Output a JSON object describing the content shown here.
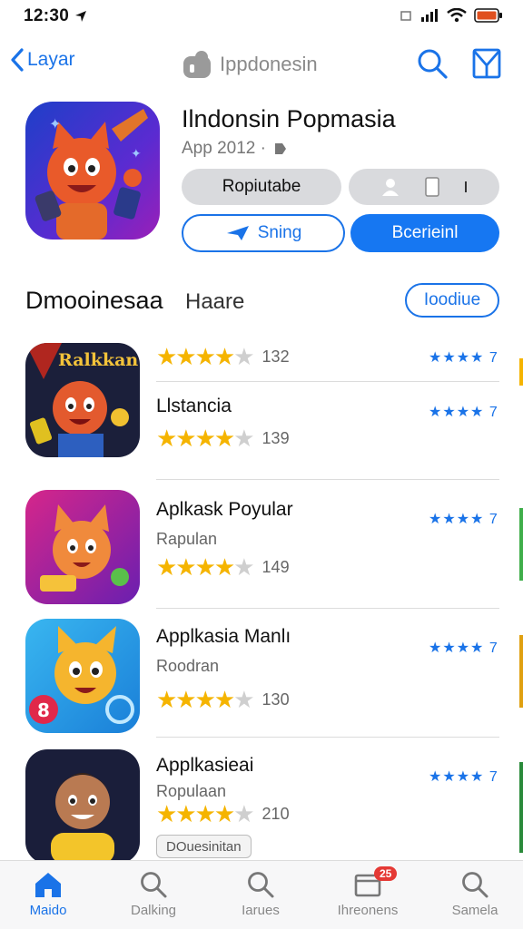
{
  "status": {
    "time": "12:30"
  },
  "nav": {
    "back_label": "Layar",
    "title": "Ippdonesin"
  },
  "hero": {
    "title": "Ilndonsin Popmasia",
    "subtitle": "App 2012 ·",
    "gray_button": "Ropiutabe",
    "outline_button": "Sning",
    "primary_button": "Bcerieinl"
  },
  "section": {
    "title": "Dmooinesaa",
    "subtitle": "Haare",
    "button": "Ioodiue"
  },
  "apps": [
    {
      "title": "",
      "subtitle": "",
      "icon_text": "Ralkkan",
      "stars": 4.5,
      "rating_count": "132",
      "mini_stars": "★★★★ 7"
    },
    {
      "title": "Llstancia",
      "subtitle": "",
      "stars": 4.5,
      "rating_count": "139",
      "mini_stars": "★★★★ 7"
    },
    {
      "title": "Aplkask Poyular",
      "subtitle": "Rapulan",
      "stars": 4.5,
      "rating_count": "149",
      "mini_stars": "★★★★ 7"
    },
    {
      "title": "Applkasia Manlı",
      "subtitle": "Roodran",
      "stars": 4.5,
      "rating_count": "130",
      "mini_stars": "★★★★ 7"
    },
    {
      "title": "Applkasieai",
      "subtitle": "Ropulaan",
      "stars": 4.5,
      "rating_count": "210",
      "mini_stars": "★★★★ 7",
      "badge": "DOuesinitan"
    }
  ],
  "tabs": [
    {
      "label": "Maido",
      "icon": "home-icon",
      "active": true
    },
    {
      "label": "Dalking",
      "icon": "search-icon"
    },
    {
      "label": "Iarues",
      "icon": "search-icon"
    },
    {
      "label": "Ihreonens",
      "icon": "inbox-icon",
      "badge": "25"
    },
    {
      "label": "Samela",
      "icon": "search-icon"
    }
  ],
  "colors": {
    "accent": "#1a73e8",
    "primary_button": "#1677f2",
    "star": "#f5b400",
    "badge": "#e53935"
  }
}
